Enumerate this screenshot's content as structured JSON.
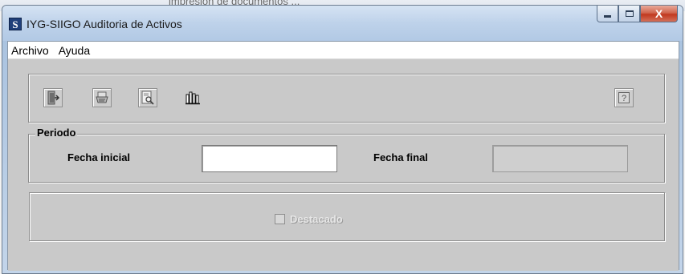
{
  "background": {
    "ghost_text": "impresión de documentos ... "
  },
  "window": {
    "title": "IYG-SIIGO Auditoria de Activos",
    "app_icon_letter": "S",
    "close_glyph": "X"
  },
  "menu": {
    "items": [
      {
        "label": "Archivo"
      },
      {
        "label": "Ayuda"
      }
    ]
  },
  "toolbar": {
    "buttons": [
      {
        "name": "exit-button",
        "icon": "exit-door-icon"
      },
      {
        "name": "print-button",
        "icon": "printer-icon"
      },
      {
        "name": "preview-button",
        "icon": "print-preview-icon"
      },
      {
        "name": "report-button",
        "icon": "bar-chart-icon"
      },
      {
        "name": "help-button",
        "icon": "help-icon"
      }
    ],
    "help_glyph": "?"
  },
  "periodo": {
    "group_label": "Periodo",
    "fecha_inicial_label": "Fecha inicial",
    "fecha_inicial_value": "",
    "fecha_final_label": "Fecha final",
    "fecha_final_value": ""
  },
  "options": {
    "destacado_label": "Destacado",
    "destacado_checked": false
  }
}
